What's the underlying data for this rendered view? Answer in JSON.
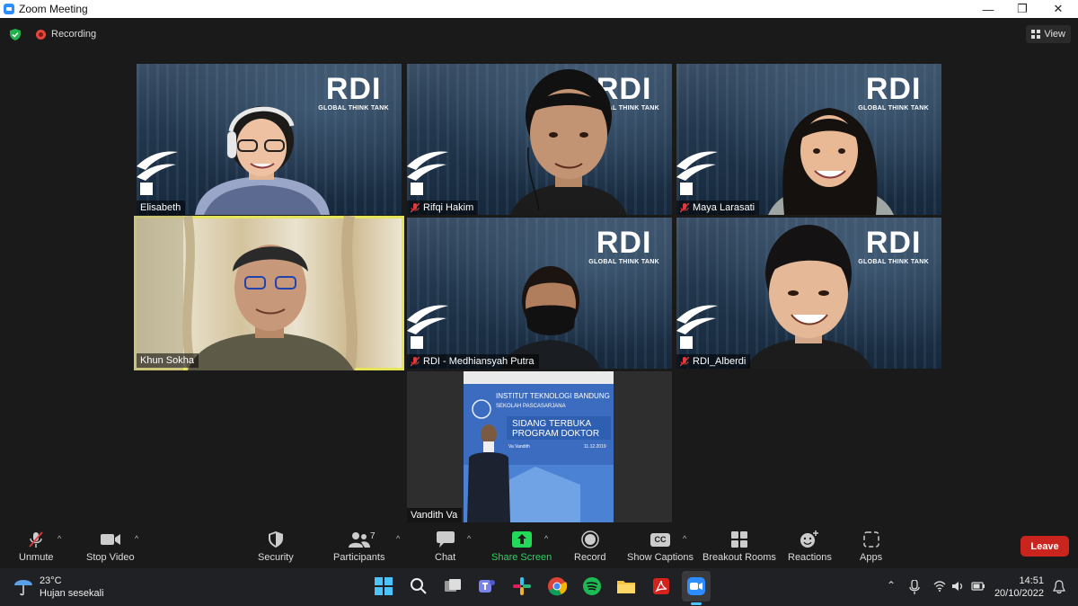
{
  "window": {
    "title": "Zoom Meeting",
    "minimize": "—",
    "restore": "❐",
    "close": "✕"
  },
  "topbar": {
    "recording_label": "Recording",
    "view_label": "View"
  },
  "participants": [
    {
      "name": "Elisabeth",
      "muted": false
    },
    {
      "name": "Rifqi Hakim",
      "muted": true
    },
    {
      "name": "Maya Larasati",
      "muted": true
    },
    {
      "name": "Khun Sokha",
      "muted": false,
      "active_speaker": true
    },
    {
      "name": "RDI - Medhiansyah Putra",
      "muted": true
    },
    {
      "name": "RDI_Alberdi",
      "muted": true
    },
    {
      "name": "Vandith Va",
      "muted": false
    }
  ],
  "rdi_background": {
    "logo": "RDI",
    "tagline": "GLOBAL THINK TANK"
  },
  "poster": {
    "line1": "INSTITUT TEKNOLOGI BANDUNG",
    "line2": "SEKOLAH PASCASARJANA",
    "line3": "SIDANG TERBUKA",
    "line4": "PROGRAM DOKTOR",
    "line5": "Va Vandith",
    "line6": "11.12.2019"
  },
  "toolbar": {
    "unmute": "Unmute",
    "stop_video": "Stop Video",
    "security": "Security",
    "participants": "Participants",
    "participants_count": "7",
    "chat": "Chat",
    "share_screen": "Share Screen",
    "record": "Record",
    "show_captions": "Show Captions",
    "captions_icon": "CC",
    "breakout_rooms": "Breakout Rooms",
    "reactions": "Reactions",
    "apps": "Apps",
    "leave": "Leave",
    "share_color": "#23d959",
    "leave_color": "#c9241d"
  },
  "taskbar": {
    "temperature": "23°C",
    "weather_desc": "Hujan sesekali",
    "time": "14:51",
    "date": "20/10/2022",
    "apps": [
      "windows-start",
      "search",
      "task-view",
      "teams",
      "slack",
      "chrome",
      "spotify",
      "file-explorer",
      "acrobat",
      "zoom"
    ]
  }
}
